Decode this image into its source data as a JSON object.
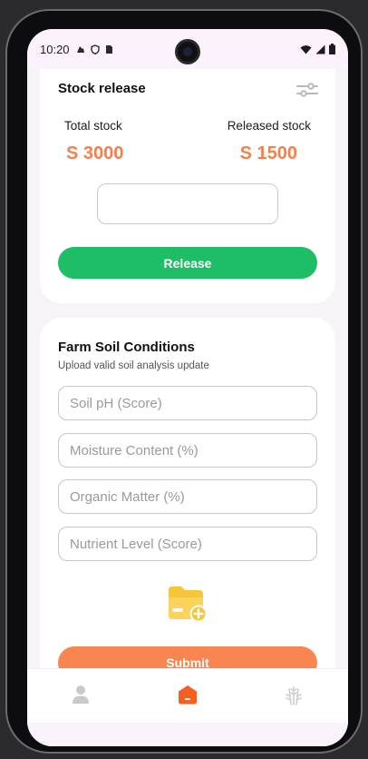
{
  "status_bar": {
    "time": "10:20"
  },
  "stock_release": {
    "title": "Stock release",
    "total_label": "Total stock",
    "total_value": "S 3000",
    "released_label": "Released stock",
    "released_value": "S 1500",
    "amount_value": "",
    "release_button": "Release"
  },
  "soil_conditions": {
    "title": "Farm Soil Conditions",
    "subtitle": "Upload valid soil analysis update",
    "fields": [
      {
        "placeholder": "Soil pH (Score)",
        "value": ""
      },
      {
        "placeholder": "Moisture Content (%)",
        "value": ""
      },
      {
        "placeholder": "Organic Matter (%)",
        "value": ""
      },
      {
        "placeholder": "Nutrient Level (Score)",
        "value": ""
      }
    ],
    "submit_button": "Submit"
  },
  "bottom_nav": {
    "items": [
      {
        "icon": "person-icon",
        "active": false
      },
      {
        "icon": "home-icon",
        "active": true
      },
      {
        "icon": "wheat-icon",
        "active": false
      }
    ]
  },
  "colors": {
    "accent_orange": "#f4814c",
    "release_green": "#1dbe66",
    "folder_yellow": "#f7c53a"
  }
}
